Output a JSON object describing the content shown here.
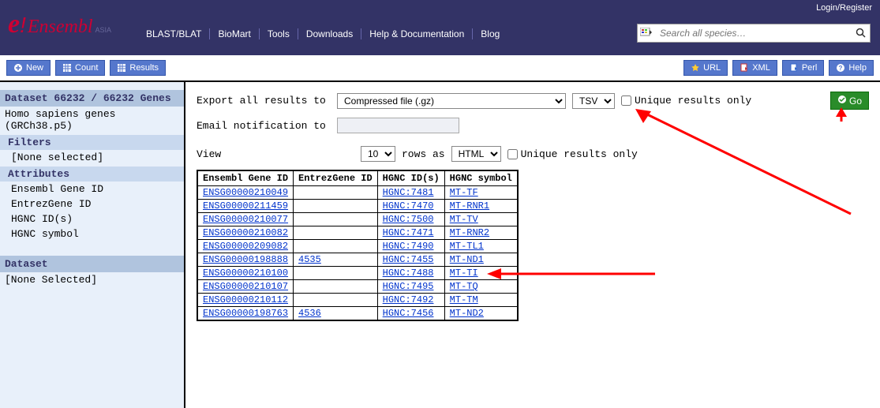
{
  "topnav": {
    "login_register": "Login/Register",
    "logo_asia": "ASIA",
    "menu": [
      "BLAST/BLAT",
      "BioMart",
      "Tools",
      "Downloads",
      "Help & Documentation",
      "Blog"
    ],
    "search_placeholder": "Search all species…"
  },
  "toolbar": {
    "left": [
      {
        "label": "New",
        "icon": "plus-circle"
      },
      {
        "label": "Count",
        "icon": "grid"
      },
      {
        "label": "Results",
        "icon": "grid"
      }
    ],
    "right": [
      {
        "label": "URL",
        "icon": "star"
      },
      {
        "label": "XML",
        "icon": "doc-export"
      },
      {
        "label": "Perl",
        "icon": "doc-export"
      },
      {
        "label": "Help",
        "icon": "question"
      }
    ]
  },
  "sidebar": {
    "dataset_header": "Dataset 66232 / 66232 Genes",
    "dataset_name": "Homo sapiens genes (GRCh38.p5)",
    "filters_label": "Filters",
    "filters_value": "[None selected]",
    "attributes_label": "Attributes",
    "attributes": [
      "Ensembl Gene ID",
      "EntrezGene ID",
      "HGNC ID(s)",
      "HGNC symbol"
    ],
    "dataset2_header": "Dataset",
    "dataset2_value": "[None Selected]"
  },
  "content": {
    "export_to_label": "Export all results to",
    "export_format_options": [
      "Compressed file (.gz)"
    ],
    "export_format_selected": "Compressed file (.gz)",
    "export_type_options": [
      "TSV"
    ],
    "export_type_selected": "TSV",
    "unique_results_label": "Unique results only",
    "go_label": "Go",
    "email_label": "Email notification to",
    "email_value": "",
    "view_label": "View",
    "view_rows_options": [
      "10"
    ],
    "view_rows_selected": "10",
    "view_rows_as": "rows as",
    "view_format_options": [
      "HTML"
    ],
    "view_format_selected": "HTML",
    "table": {
      "headers": [
        "Ensembl Gene ID",
        "EntrezGene ID",
        "HGNC ID(s)",
        "HGNC symbol"
      ],
      "rows": [
        {
          "ensembl": "ENSG00000210049",
          "entrez": "",
          "hgnc": "HGNC:7481",
          "symbol": "MT-TF"
        },
        {
          "ensembl": "ENSG00000211459",
          "entrez": "",
          "hgnc": "HGNC:7470",
          "symbol": "MT-RNR1"
        },
        {
          "ensembl": "ENSG00000210077",
          "entrez": "",
          "hgnc": "HGNC:7500",
          "symbol": "MT-TV"
        },
        {
          "ensembl": "ENSG00000210082",
          "entrez": "",
          "hgnc": "HGNC:7471",
          "symbol": "MT-RNR2"
        },
        {
          "ensembl": "ENSG00000209082",
          "entrez": "",
          "hgnc": "HGNC:7490",
          "symbol": "MT-TL1"
        },
        {
          "ensembl": "ENSG00000198888",
          "entrez": "4535",
          "hgnc": "HGNC:7455",
          "symbol": "MT-ND1"
        },
        {
          "ensembl": "ENSG00000210100",
          "entrez": "",
          "hgnc": "HGNC:7488",
          "symbol": "MT-TI"
        },
        {
          "ensembl": "ENSG00000210107",
          "entrez": "",
          "hgnc": "HGNC:7495",
          "symbol": "MT-TQ"
        },
        {
          "ensembl": "ENSG00000210112",
          "entrez": "",
          "hgnc": "HGNC:7492",
          "symbol": "MT-TM"
        },
        {
          "ensembl": "ENSG00000198763",
          "entrez": "4536",
          "hgnc": "HGNC:7456",
          "symbol": "MT-ND2"
        }
      ]
    }
  }
}
